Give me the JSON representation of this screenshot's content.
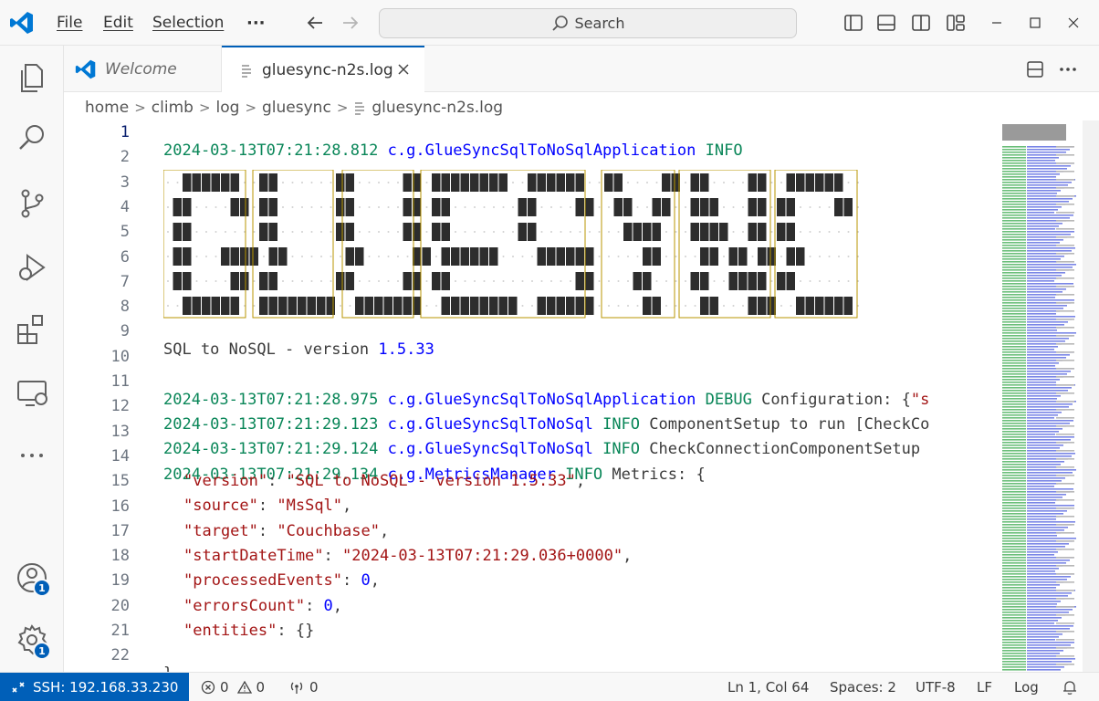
{
  "menu": {
    "file": "File",
    "edit": "Edit",
    "selection": "Selection",
    "more": "···"
  },
  "search": {
    "label": "Search"
  },
  "tabs": [
    {
      "label": "Welcome",
      "icon": "vscode-logo-icon"
    },
    {
      "label": "gluesync-n2s.log",
      "icon": "file-lines-icon"
    }
  ],
  "breadcrumb": [
    "home",
    "climb",
    "log",
    "gluesync",
    "gluesync-n2s.log"
  ],
  "editor": {
    "line_numbers": [
      "1",
      "2",
      "3",
      "4",
      "5",
      "6",
      "7",
      "8",
      "9",
      "10",
      "11",
      "12",
      "13",
      "14",
      "15",
      "16",
      "17",
      "18",
      "19",
      "20",
      "21",
      "22"
    ],
    "line1": {
      "date": "2024-03-13T07:21:28.812",
      "cls": "c.g.GlueSyncSqlToNoSqlApplication",
      "lvl": "INFO"
    },
    "line9": {
      "text": "SQL to NoSQL - version ",
      "ver": "1.5.33"
    },
    "line11": {
      "date": "2024-03-13T07:21:28.975",
      "cls": "c.g.GlueSyncSqlToNoSqlApplication",
      "lvl": "DEBUG",
      "msg": "Configuration: {",
      "tail": "\"s"
    },
    "line12": {
      "date": "2024-03-13T07:21:29.123",
      "cls": "c.g.GlueSyncSqlToNoSql",
      "lvl": "INFO",
      "msg": "ComponentSetup to run [CheckCo"
    },
    "line13": {
      "date": "2024-03-13T07:21:29.124",
      "cls": "c.g.GlueSyncSqlToNoSql",
      "lvl": "INFO",
      "msg": "CheckConnectionComponentSetup"
    },
    "line14": {
      "date": "2024-03-13T07:21:29.134",
      "cls": "c.g.MetricsManager",
      "lvl": "INFO",
      "msg": "Metrics: {"
    },
    "json": [
      {
        "key": "\"version\"",
        "val": "\"SQL to NoSQL - version 1.5.33\"",
        "type": "str",
        "comma": ","
      },
      {
        "key": "\"source\"",
        "val": "\"MsSql\"",
        "type": "str",
        "comma": ","
      },
      {
        "key": "\"target\"",
        "val": "\"Couchbase\"",
        "type": "str",
        "comma": ","
      },
      {
        "key": "\"startDateTime\"",
        "val": "\"2024-03-13T07:21:29.036+0000\"",
        "type": "str",
        "comma": ","
      },
      {
        "key": "\"processedEvents\"",
        "val": "0",
        "type": "num",
        "comma": ","
      },
      {
        "key": "\"errorsCount\"",
        "val": "0",
        "type": "num",
        "comma": ","
      },
      {
        "key": "\"entities\"",
        "val": "{}",
        "type": "txt",
        "comma": ""
      }
    ],
    "line22": "}"
  },
  "status": {
    "remote": "SSH: 192.168.33.230",
    "errors": "0",
    "warnings": "0",
    "ports": "0",
    "position": "Ln 1, Col 64",
    "spaces": "Spaces: 2",
    "encoding": "UTF-8",
    "eol": "LF",
    "language": "Log"
  },
  "badges": {
    "accounts": "1",
    "manage": "1"
  },
  "colors": {
    "accent": "#005fb8",
    "date": "#098658",
    "class": "#0000ff",
    "string": "#a31515"
  }
}
